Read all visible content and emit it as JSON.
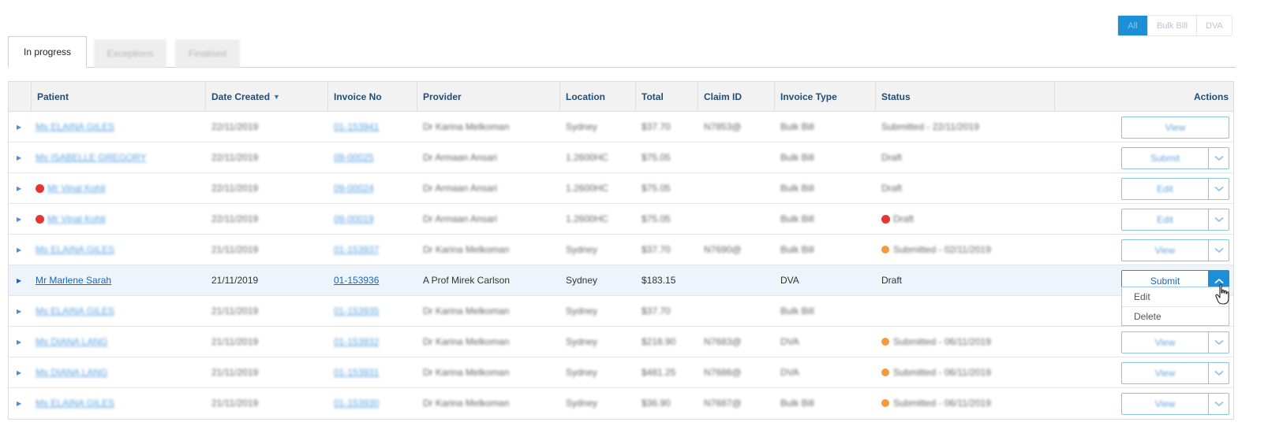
{
  "filters": [
    "All",
    "Bulk Bill",
    "DVA"
  ],
  "tabs": [
    "In progress",
    "Exceptions",
    "Finalised"
  ],
  "columns": {
    "patient": "Patient",
    "date_created": "Date Created",
    "invoice_no": "Invoice No",
    "provider": "Provider",
    "location": "Location",
    "total": "Total",
    "claim_id": "Claim ID",
    "invoice_type": "Invoice Type",
    "status": "Status",
    "actions": "Actions"
  },
  "rows": [
    {
      "patient": "Ms ELAINA GILES",
      "date": "22/11/2019",
      "invoice": "01-153941",
      "provider": "Dr Karina Melkoman",
      "location": "Sydney",
      "total": "$37.70",
      "claim": "N7853@",
      "type": "Bulk Bill",
      "status": "Submitted - 22/11/2019",
      "action": "View"
    },
    {
      "patient": "Ms ISABELLE GREGORY",
      "date": "22/11/2019",
      "invoice": "09-00025",
      "provider": "Dr Armaan Ansari",
      "location": "1.2600HC",
      "total": "$75.05",
      "claim": "",
      "type": "Bulk Bill",
      "status": "Draft",
      "action": "Submit"
    },
    {
      "patient": "Mr Vinal Kohli",
      "date": "22/11/2019",
      "invoice": "09-00024",
      "provider": "Dr Armaan Ansari",
      "location": "1.2600HC",
      "total": "$75.05",
      "claim": "",
      "type": "Bulk Bill",
      "status": "Draft",
      "action": "Edit"
    },
    {
      "patient": "Mr Vinal Kohli",
      "date": "22/11/2019",
      "invoice": "09-00019",
      "provider": "Dr Armaan Ansari",
      "location": "1.2600HC",
      "total": "$75.05",
      "claim": "",
      "type": "Bulk Bill",
      "status": "Draft",
      "action": "Edit"
    },
    {
      "patient": "Ms ELAINA GILES",
      "date": "21/11/2019",
      "invoice": "01-153937",
      "provider": "Dr Karina Melkoman",
      "location": "Sydney",
      "total": "$37.70",
      "claim": "N7690@",
      "type": "Bulk Bill",
      "status": "Submitted - 02/11/2019",
      "action": "View"
    },
    {
      "patient": "Mr Marlene Sarah",
      "date": "21/11/2019",
      "invoice": "01-153936",
      "provider": "A Prof Mirek Carlson",
      "location": "Sydney",
      "total": "$183.15",
      "claim": "",
      "type": "DVA",
      "status": "Draft",
      "action": "Submit"
    },
    {
      "patient": "Ms ELAINA GILES",
      "date": "21/11/2019",
      "invoice": "01-153935",
      "provider": "Dr Karina Melkoman",
      "location": "Sydney",
      "total": "$37.70",
      "claim": "",
      "type": "Bulk Bill",
      "status": "",
      "action": ""
    },
    {
      "patient": "Ms DIANA LANG",
      "date": "21/11/2019",
      "invoice": "01-153932",
      "provider": "Dr Karina Melkoman",
      "location": "Sydney",
      "total": "$218.90",
      "claim": "N7683@",
      "type": "DVA",
      "status": "Submitted - 06/11/2019",
      "action": "View"
    },
    {
      "patient": "Ms DIANA LANG",
      "date": "21/11/2019",
      "invoice": "01-153931",
      "provider": "Dr Karina Melkoman",
      "location": "Sydney",
      "total": "$481.25",
      "claim": "N7686@",
      "type": "DVA",
      "status": "Submitted - 06/11/2019",
      "action": "View"
    },
    {
      "patient": "Ms ELAINA GILES",
      "date": "21/11/2019",
      "invoice": "01-153930",
      "provider": "Dr Karina Melkoman",
      "location": "Sydney",
      "total": "$36.90",
      "claim": "N7687@",
      "type": "Bulk Bill",
      "status": "Submitted - 06/11/2019",
      "action": "View"
    }
  ],
  "dropdown_menu": [
    "Edit",
    "Delete"
  ],
  "colors": {
    "accent": "#1d8fd7",
    "link": "#1a66b8",
    "header_text": "#1f4e79",
    "status_red": "#e8342f",
    "status_orange": "#f59a3c"
  }
}
